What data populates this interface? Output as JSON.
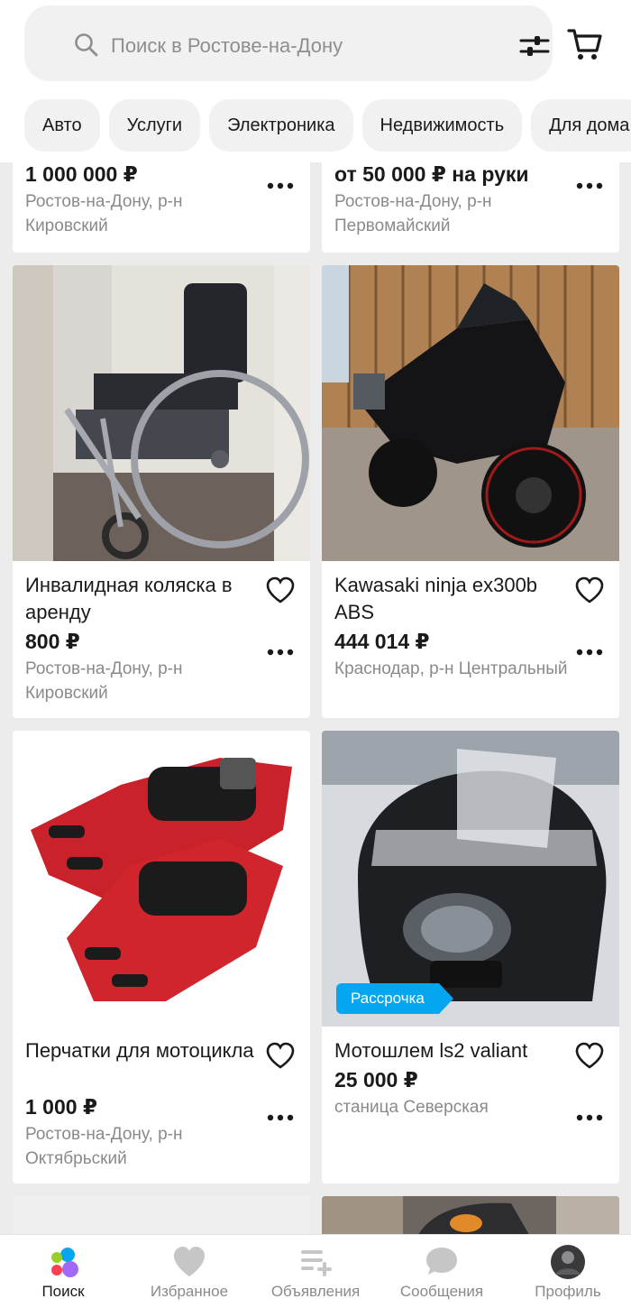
{
  "search": {
    "placeholder": "Поиск в Ростове-на-Дону"
  },
  "categories": [
    "Авто",
    "Услуги",
    "Электроника",
    "Недвижимость",
    "Для дома"
  ],
  "listings": [
    {
      "price": "1 000 000 ₽",
      "location": "Ростов-на-Дону, р-н Кировский"
    },
    {
      "price": "от 50 000 ₽ на руки",
      "location": "Ростов-на-Дону, р-н Первомайский"
    },
    {
      "title": "Инвалидная коляска в аренду",
      "price": "800 ₽",
      "location": "Ростов-на-Дону, р-н Кировский"
    },
    {
      "title": "Kawasaki ninja ex300b ABS",
      "price": "444 014 ₽",
      "location": "Краснодар, р-н Центральный"
    },
    {
      "title": "Перчатки для мотоцикла",
      "price": "1 000 ₽",
      "location": "Ростов-на-Дону, р-н Октябрьский"
    },
    {
      "title": "Мотошлем ls2 valiant",
      "price": "25 000 ₽",
      "location": "станица Северская",
      "badge": "Рассрочка"
    }
  ],
  "nav": [
    {
      "label": "Поиск",
      "icon": "search-logo-icon",
      "active": true
    },
    {
      "label": "Избранное",
      "icon": "heart-icon"
    },
    {
      "label": "Объявления",
      "icon": "ads-add-icon"
    },
    {
      "label": "Сообщения",
      "icon": "chat-icon"
    },
    {
      "label": "Профиль",
      "icon": "avatar-icon"
    }
  ],
  "colors": {
    "accent": "#05a6f0",
    "chip_bg": "#f1f1f1",
    "background": "#ececec"
  }
}
